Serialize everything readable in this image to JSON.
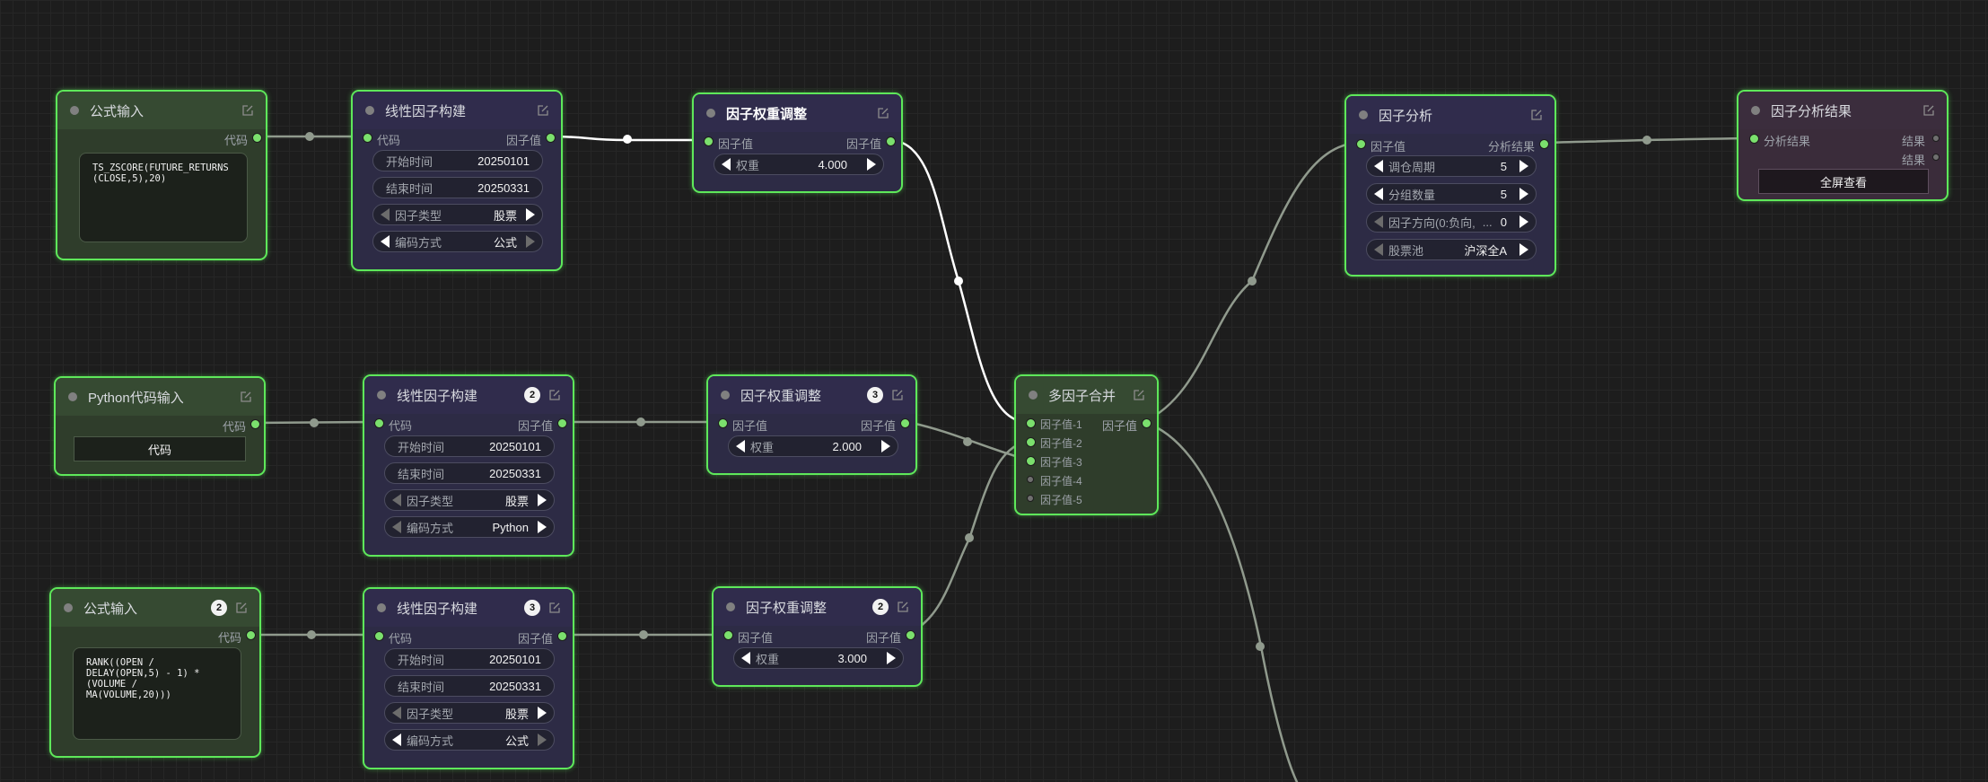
{
  "colors": {
    "accent": "#5ee85a",
    "port": "#7be06d",
    "wire_active": "#ffffff",
    "wire": "#909a8d",
    "canvas": "#1d1d1d"
  },
  "nodes": {
    "formula1": {
      "title": "公式输入",
      "out": "代码",
      "code": "TS_ZSCORE(FUTURE_RETURNS\n(CLOSE,5),20)"
    },
    "linear1": {
      "title": "线性因子构建",
      "in": "代码",
      "out": "因子值",
      "start_label": "开始时间",
      "start_value": "20250101",
      "end_label": "结束时间",
      "end_value": "20250331",
      "type_label": "因子类型",
      "type_value": "股票",
      "enc_label": "编码方式",
      "enc_value": "公式"
    },
    "weight1": {
      "title": "因子权重调整",
      "in": "因子值",
      "out": "因子值",
      "w_label": "权重",
      "w_value": "4.000"
    },
    "analysis": {
      "title": "因子分析",
      "in": "因子值",
      "out": "分析结果",
      "f1_label": "调仓周期",
      "f1_value": "5",
      "f2_label": "分组数量",
      "f2_value": "5",
      "f3_label": "因子方向(0:负向,",
      "f3_ellipsis": "...",
      "f3_value": "0",
      "f4_label": "股票池",
      "f4_value": "沪深全A"
    },
    "result": {
      "title": "因子分析结果",
      "in": "分析结果",
      "out1": "结果",
      "out2": "结果",
      "button": "全屏查看"
    },
    "python": {
      "title": "Python代码输入",
      "out": "代码",
      "button": "代码"
    },
    "linear2": {
      "title": "线性因子构建",
      "badge": "2",
      "in": "代码",
      "out": "因子值",
      "start_label": "开始时间",
      "start_value": "20250101",
      "end_label": "结束时间",
      "end_value": "20250331",
      "type_label": "因子类型",
      "type_value": "股票",
      "enc_label": "编码方式",
      "enc_value": "Python"
    },
    "weight2": {
      "title": "因子权重调整",
      "badge": "3",
      "in": "因子值",
      "out": "因子值",
      "w_label": "权重",
      "w_value": "2.000"
    },
    "merge": {
      "title": "多因子合并",
      "in1": "因子值-1",
      "in2": "因子值-2",
      "in3": "因子值-3",
      "in4": "因子值-4",
      "in5": "因子值-5",
      "out": "因子值"
    },
    "formula2": {
      "title": "公式输入",
      "badge": "2",
      "out": "代码",
      "code": "RANK((OPEN /\nDELAY(OPEN,5) - 1) *\n(VOLUME /\nMA(VOLUME,20)))"
    },
    "linear3": {
      "title": "线性因子构建",
      "badge": "3",
      "in": "代码",
      "out": "因子值",
      "start_label": "开始时间",
      "start_value": "20250101",
      "end_label": "结束时间",
      "end_value": "20250331",
      "type_label": "因子类型",
      "type_value": "股票",
      "enc_label": "编码方式",
      "enc_value": "公式"
    },
    "weight3": {
      "title": "因子权重调整",
      "badge": "2",
      "in": "因子值",
      "out": "因子值",
      "w_label": "权重",
      "w_value": "3.000"
    }
  }
}
